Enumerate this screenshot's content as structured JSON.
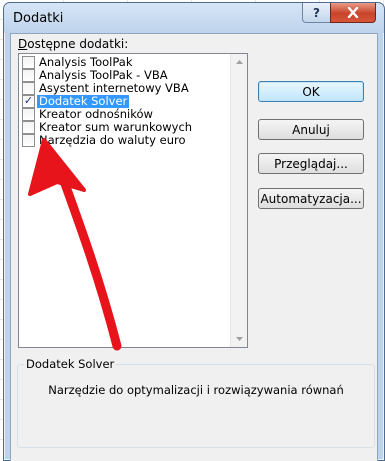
{
  "window": {
    "title": "Dodatki",
    "help_label": "?",
    "close_label": "x"
  },
  "addins": {
    "label": "Dostępne dodatki:",
    "label_underline_char": "D",
    "label_rest": "ostępne dodatki:",
    "items": [
      {
        "label": "Analysis ToolPak",
        "checked": false,
        "selected": false
      },
      {
        "label": "Analysis ToolPak - VBA",
        "checked": false,
        "selected": false
      },
      {
        "label": "Asystent internetowy VBA",
        "checked": false,
        "selected": false
      },
      {
        "label": "Dodatek Solver",
        "checked": true,
        "selected": true
      },
      {
        "label": "Kreator odnośników",
        "checked": false,
        "selected": false
      },
      {
        "label": "Kreator sum warunkowych",
        "checked": false,
        "selected": false
      },
      {
        "label": "Narzędzia do waluty euro",
        "checked": false,
        "selected": false
      }
    ]
  },
  "buttons": {
    "ok": "OK",
    "cancel": "Anuluj",
    "browse": "Przeglądaj...",
    "automation": "Automatyzacja..."
  },
  "details": {
    "title": "Dodatek Solver",
    "description": "Narzędzie do optymalizacji i rozwiązywania równań"
  },
  "colors": {
    "selection": "#3399ff",
    "annotation_arrow": "#e8141b"
  }
}
